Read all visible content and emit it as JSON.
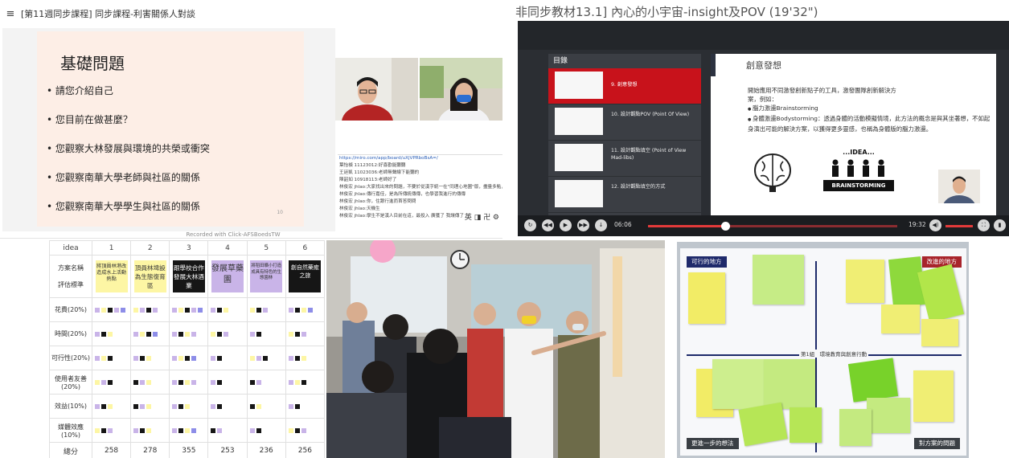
{
  "colors": {
    "red_accent": "#c8121b",
    "slide_bg": "#fdeee6",
    "board_line": "#1d2a6a",
    "tag_navy": "#1f2a6b",
    "tag_red": "#a8242b",
    "note_yellow": "#fdf6a4",
    "note_lavender": "#c9b4e8",
    "note_black": "#161616"
  },
  "meeting": {
    "window_title": "[第11週同步課程] 同步課程-利害關係人對談",
    "slide_title": "基礎問題",
    "bullets": [
      "請您介紹自己",
      "您目前在做甚麼？",
      "您觀察大林發展與環境的共榮或衝突",
      "您觀察南華大學老師與社區的關係",
      "您觀察南華大學學生與社區的關係"
    ],
    "recorded_label": "Recorded with Click-AFSBoedsTW",
    "chat_link": "https://miro.com/app/board/uXjVPRboBsA=/",
    "chat_lines": [
      "葉怡禎 11123012:好喜歡能聽聽",
      "王廷凱 11023036:老師無聲線下能聽的",
      "陳韶如 10918113:老師好了",
      "林俊宏 jhlao:大家找出來的問題，不要於從漢字統一在\"同理心地圖\"版，盡量多點，會幫他的",
      "林俊宏 jhlao:傳行嘉佳，是為所傳統傳傳，也學習我進行的傳傳",
      "林俊宏 jhlao:你，住跟行進而首答問問",
      "林俊宏 jhlao:天機生",
      "林俊宏 jhlao:學生不是漢人目前在這，最投入 廣獲了 我讓傳了"
    ],
    "chat_tools": "英 ◨ 卍 ⚙"
  },
  "player": {
    "title": "非同步教材13.1] 內心的小宇宙-insight及POV (19'32\")",
    "toc_header": "目錄",
    "toc_items": [
      {
        "label": "9. 創意發想",
        "active": true
      },
      {
        "label": "10. 設計觀點POV (Point Of View)",
        "active": false
      },
      {
        "label": "11. 設計觀點填空 (Point of View Mad-libs)",
        "active": false
      },
      {
        "label": "12. 設計觀點填空的方式",
        "active": false
      }
    ],
    "content_title": "創意發想",
    "content_lines": [
      "開始應用不同激發創新點子的工具，激發團隊創新解決方",
      "案，例如："
    ],
    "content_bullets": [
      "腦力激盪Brainstorming",
      "身體激盪Bodystorming：透過身體的活動模擬情境，此方法的概念是與其坐著想，不如起身演出可能的解決方案，以獲得更多靈感，也稱為身體版的腦力激盪。"
    ],
    "idea_label": "...IDEA...",
    "brainstorm_label": "BRAINSTORMING",
    "footnote": "資料來源：史丹佛大學設計學院之設計思考工具",
    "time_current": "06:06",
    "time_total": "19:32",
    "progress": 0.31,
    "volume": 1.0
  },
  "evaluation": {
    "header_label": "idea",
    "row_label_name": "方案名稱",
    "row_label_criteria": "評估標準",
    "ideas": [
      {
        "num": "1",
        "name": "將頂員林港改造成水上活動熱點",
        "color": "#fdf6a4",
        "text_color": "#333333"
      },
      {
        "num": "2",
        "name": "頂員林埤設為生態復育區",
        "color": "#fdf6a4",
        "text_color": "#333333"
      },
      {
        "num": "3",
        "name": "跟學校合作發展大林酒業",
        "color": "#161616",
        "text_color": "#ffffff"
      },
      {
        "num": "4",
        "name": "發展草藥園",
        "color": "#c9b4e8",
        "text_color": "#333333"
      },
      {
        "num": "5",
        "name": "將稻田曠小打造成具有特色的生態園林",
        "color": "#c9b4e8",
        "text_color": "#333333"
      },
      {
        "num": "6",
        "name": "創自然藥癒之旅",
        "color": "#161616",
        "text_color": "#ffffff"
      }
    ],
    "criteria": [
      "花費(20%)",
      "時間(20%)",
      "可行性(20%)",
      "使用者友善(20%)",
      "效益(10%)",
      "媒體效應(10%)"
    ],
    "total_label": "總分",
    "totals": [
      "258",
      "278",
      "355",
      "253",
      "236",
      "256"
    ],
    "rank_label": "排序",
    "ranks": [
      "3",
      "2",
      "1",
      "5",
      "6",
      "4"
    ]
  },
  "board": {
    "top_left_tag": "可行的地方",
    "top_right_tag": "改進的地方",
    "bottom_left_tag": "更進一步的想法",
    "bottom_right_tag": "對方案的問題",
    "center_label": "第1組　環境教育與創意行動"
  }
}
